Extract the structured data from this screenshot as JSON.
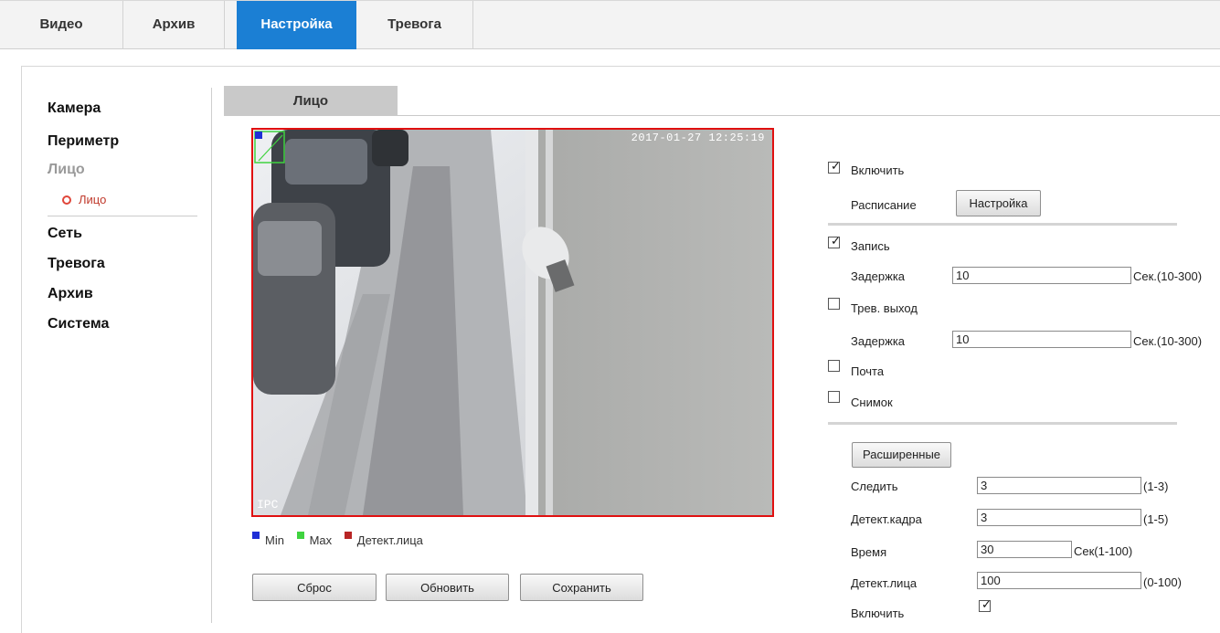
{
  "top_tabs": [
    "Видео",
    "Архив",
    "Настройка",
    "Тревога"
  ],
  "sidebar": {
    "items": [
      "Камера",
      "Периметр",
      "Лицо"
    ],
    "sub_item": "Лицо",
    "items_after": [
      "Сеть",
      "Тревога",
      "Архив",
      "Система"
    ]
  },
  "section_tab": "Лицо",
  "video": {
    "timestamp": "2017-01-27 12:25:19",
    "channel_label": "IPC"
  },
  "legend": [
    "Min",
    "Max",
    "Детект.лица"
  ],
  "legend_colors": [
    "#1f2fd6",
    "#3fd33f",
    "#b82525"
  ],
  "buttons": {
    "reset": "Сброс",
    "refresh": "Обновить",
    "save": "Сохранить"
  },
  "settings": {
    "enable_label": "Включить",
    "enable_checked": true,
    "schedule_label": "Расписание",
    "schedule_button": "Настройка",
    "record_label": "Запись",
    "record_checked": true,
    "delay_label": "Задержка",
    "record_delay": "10",
    "delay_unit": "Сек.(10-300)",
    "alarm_out_label": "Трев. выход",
    "alarm_out_checked": false,
    "alarm_delay": "10",
    "mail_label": "Почта",
    "mail_checked": false,
    "snapshot_label": "Снимок",
    "snapshot_checked": false,
    "advanced_button": "Расширенные",
    "track_label": "Следить",
    "track_value": "3",
    "track_range": "(1-3)",
    "frame_label": "Детект.кадра",
    "frame_value": "3",
    "frame_range": "(1-5)",
    "time_label": "Время",
    "time_value": "30",
    "time_range": "Сек(1-100)",
    "face_label": "Детект.лица",
    "face_value": "100",
    "face_range": "(0-100)",
    "enable2_label": "Включить",
    "enable2_checked": true
  }
}
